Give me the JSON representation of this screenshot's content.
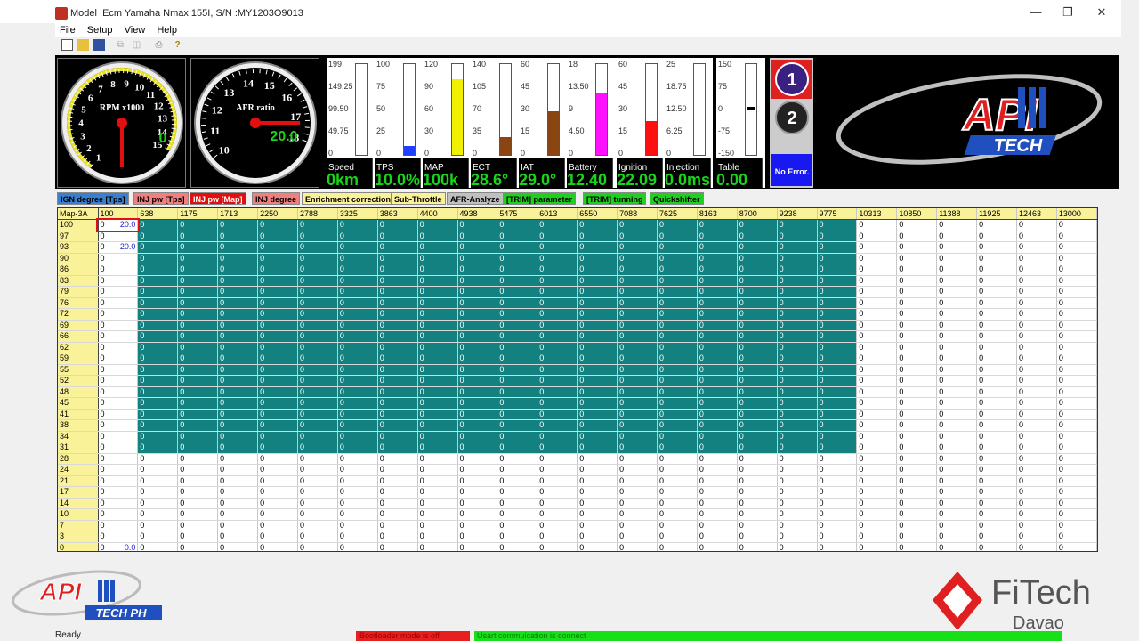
{
  "window": {
    "title": "Model :Ecm Yamaha Nmax 155I, S/N :MY1203O9013"
  },
  "menus": [
    "File",
    "Setup",
    "View",
    "Help"
  ],
  "gauges": {
    "rpm": {
      "label": "RPM x1000",
      "value": "0",
      "ticks": [
        "1",
        "2",
        "3",
        "4",
        "5",
        "6",
        "7",
        "8",
        "9",
        "10",
        "11",
        "12",
        "13",
        "14",
        "15"
      ]
    },
    "afr": {
      "label": "AFR ratio",
      "value": "20.0",
      "ticks": [
        "10",
        "11",
        "12",
        "13",
        "14",
        "15",
        "16",
        "17",
        "18"
      ]
    }
  },
  "bars": [
    {
      "name": "Speed",
      "value": "0km",
      "ticks": [
        "199",
        "149.25",
        "99.50",
        "49.75",
        "0"
      ],
      "level": 0,
      "color": "#ffffff"
    },
    {
      "name": "TPS",
      "value": "10.0%",
      "ticks": [
        "100",
        "75",
        "50",
        "25",
        "0"
      ],
      "level": 0.1,
      "color": "#2040ff"
    },
    {
      "name": "MAP",
      "value": "100k",
      "ticks": [
        "120",
        "90",
        "60",
        "30",
        "0"
      ],
      "level": 0.83,
      "color": "#f0f000"
    },
    {
      "name": "ECT",
      "value": "28.6°",
      "ticks": [
        "140",
        "105",
        "70",
        "35",
        "0"
      ],
      "level": 0.2,
      "color": "#8b4513"
    },
    {
      "name": "IAT",
      "value": "29.0°",
      "ticks": [
        "60",
        "45",
        "30",
        "15",
        "0"
      ],
      "level": 0.48,
      "color": "#8b4513"
    },
    {
      "name": "Battery",
      "value": "12.40",
      "ticks": [
        "18",
        "13.50",
        "9",
        "4.50",
        "0"
      ],
      "level": 0.69,
      "color": "#ff10ff"
    },
    {
      "name": "Ignition",
      "value": "22.09",
      "ticks": [
        "60",
        "45",
        "30",
        "15",
        "0"
      ],
      "level": 0.37,
      "color": "#ff1010"
    },
    {
      "name": "Injection",
      "value": "0.0ms",
      "ticks": [
        "25",
        "18.75",
        "12.50",
        "6.25",
        "0"
      ],
      "level": 0,
      "color": "#ffffff"
    },
    {
      "name": "Table",
      "value": "0.00",
      "ticks": [
        "150",
        "75",
        "0",
        "-75",
        "-150"
      ],
      "level": 0,
      "color": "#ffffff"
    }
  ],
  "status_pad": {
    "btn1": "1",
    "btn2": "2",
    "error": "No Error."
  },
  "logo": {
    "top": "API",
    "bottom": "TECH"
  },
  "tabs": [
    {
      "label": "IGN degree [Tps]",
      "bg": "#3a7fd0",
      "fg": "#000"
    },
    {
      "label": "INJ pw [Tps]",
      "bg": "#f08080",
      "fg": "#000"
    },
    {
      "label": "INJ pw [Map]",
      "bg": "#e01010",
      "fg": "#fff"
    },
    {
      "label": "INJ degree",
      "bg": "#f08080",
      "fg": "#000"
    },
    {
      "label": "Enrichment correction",
      "bg": "#f9f299",
      "fg": "#000"
    },
    {
      "label": "Sub-Throttle",
      "bg": "#f9f299",
      "fg": "#000"
    },
    {
      "label": "AFR-Analyze",
      "bg": "#c0c0c0",
      "fg": "#000"
    },
    {
      "label": "[TRIM] parameter",
      "bg": "#20d020",
      "fg": "#000"
    },
    {
      "label": "[TRIM] tunning",
      "bg": "#20d020",
      "fg": "#000"
    },
    {
      "label": "Quickshifter",
      "bg": "#20d020",
      "fg": "#000"
    }
  ],
  "table": {
    "corner": "Map-3A",
    "columns": [
      "100",
      "638",
      "1175",
      "1713",
      "2250",
      "2788",
      "3325",
      "3863",
      "4400",
      "4938",
      "5475",
      "6013",
      "6550",
      "7088",
      "7625",
      "8163",
      "8700",
      "9238",
      "9775",
      "10313",
      "10850",
      "11388",
      "11925",
      "12463",
      "13000"
    ],
    "rows": [
      "100",
      "97",
      "93",
      "90",
      "86",
      "83",
      "79",
      "76",
      "72",
      "69",
      "66",
      "62",
      "59",
      "55",
      "52",
      "48",
      "45",
      "41",
      "38",
      "34",
      "31",
      "28",
      "24",
      "21",
      "17",
      "14",
      "10",
      "7",
      "3",
      "0"
    ],
    "cell_value": "0",
    "first_col_values": {
      "100": "20.0",
      "93": "20.0",
      "0": "0.0"
    }
  },
  "status": {
    "ready": "Ready",
    "bootloader": "Bootloader mode is off",
    "usart": "Usart commuication is connect"
  },
  "watermarks": {
    "left": "API TECH PH",
    "right": "FiTech Davao"
  }
}
